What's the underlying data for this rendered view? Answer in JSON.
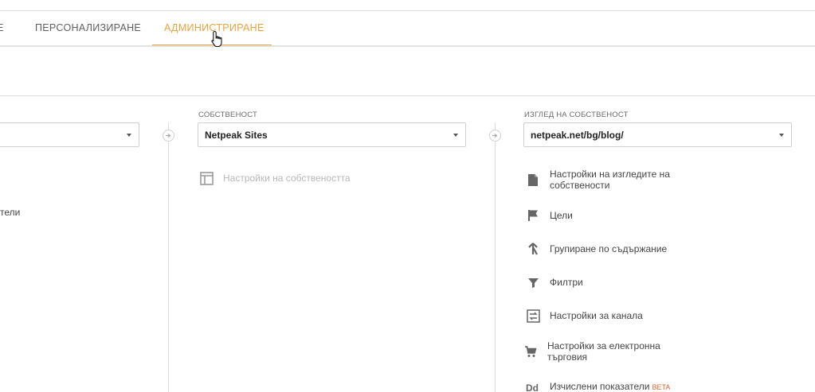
{
  "tabs": {
    "prev_label": "Е",
    "personal_label": "ПЕРСОНАЛИЗИРАНЕ",
    "admin_label": "АДМИНИСТРИРАНЕ"
  },
  "account_column": {
    "partial_item_label": "тели"
  },
  "property_column": {
    "label": "СОБСТВЕНОСТ",
    "selected": "Netpeak Sites",
    "items": [
      {
        "label": "Настройки на собствеността",
        "icon": "layout-icon",
        "disabled": true
      }
    ]
  },
  "view_column": {
    "label": "ИЗГЛЕД НА СОБСТВЕНОСТ",
    "selected": "netpeak.net/bg/blog/",
    "items": [
      {
        "label": "Настройки на изгледите на собствености",
        "icon": "document-icon"
      },
      {
        "label": "Цели",
        "icon": "flag-icon"
      },
      {
        "label": "Групиране по съдържание",
        "icon": "grouping-icon"
      },
      {
        "label": "Филтри",
        "icon": "filter-icon"
      },
      {
        "label": "Настройки за канала",
        "icon": "channel-icon"
      },
      {
        "label": "Настройки за електронна търговия",
        "icon": "cart-icon"
      },
      {
        "label": "Изчислени показатели",
        "icon": "calculated-metrics-icon",
        "badge": "BETA"
      }
    ]
  }
}
